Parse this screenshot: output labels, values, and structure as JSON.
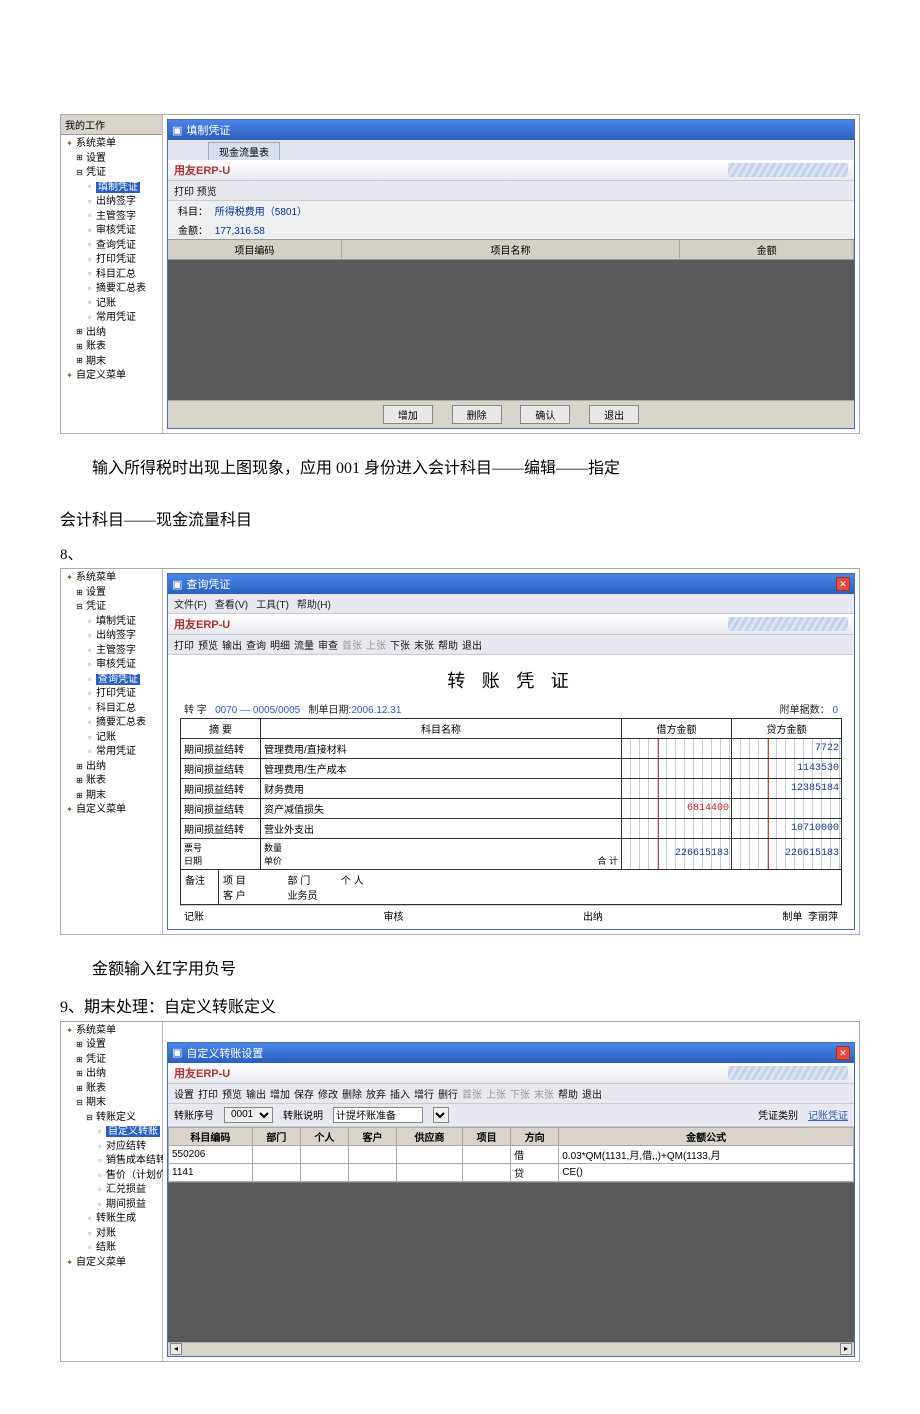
{
  "tree_header": "我的工作",
  "tree1": {
    "items": [
      {
        "label": "系统菜单",
        "lv": 0,
        "icon": "book"
      },
      {
        "label": "设置",
        "lv": 1,
        "icon": "plus"
      },
      {
        "label": "凭证",
        "lv": 1,
        "icon": "minus"
      },
      {
        "label": "填制凭证",
        "lv": 2,
        "icon": "doc",
        "hl": true
      },
      {
        "label": "出纳签字",
        "lv": 2,
        "icon": "doc"
      },
      {
        "label": "主管签字",
        "lv": 2,
        "icon": "doc"
      },
      {
        "label": "审核凭证",
        "lv": 2,
        "icon": "doc"
      },
      {
        "label": "查询凭证",
        "lv": 2,
        "icon": "doc"
      },
      {
        "label": "打印凭证",
        "lv": 2,
        "icon": "doc"
      },
      {
        "label": "科目汇总",
        "lv": 2,
        "icon": "doc"
      },
      {
        "label": "摘要汇总表",
        "lv": 2,
        "icon": "doc"
      },
      {
        "label": "记账",
        "lv": 2,
        "icon": "doc"
      },
      {
        "label": "常用凭证",
        "lv": 2,
        "icon": "doc"
      },
      {
        "label": "出纳",
        "lv": 1,
        "icon": "plus"
      },
      {
        "label": "账表",
        "lv": 1,
        "icon": "plus"
      },
      {
        "label": "期末",
        "lv": 1,
        "icon": "plus"
      },
      {
        "label": "自定义菜单",
        "lv": 0,
        "icon": "book"
      }
    ]
  },
  "shot1": {
    "title": "填制凭证",
    "tab": "现金流量表",
    "subject_label": "科目：",
    "subject_value": "所得税费用（5801）",
    "amount_label": "金额：",
    "amount_value": "177,316.58",
    "col1": "项目编码",
    "col2": "项目名称",
    "col3": "金额",
    "btn_add": "增加",
    "btn_del": "删除",
    "btn_ok": "确认",
    "btn_exit": "退出",
    "brand": "用友ERP-",
    "brand_u": "U",
    "toolbar_left": "打印 预览"
  },
  "para1a": "输入所得税时出现上图现象，应用 001 身份进入会计科目——编辑——指定",
  "para1b": "会计科目——现金流量科目",
  "section8": "8、",
  "tree2": {
    "items": [
      {
        "label": "系统菜单",
        "lv": 0,
        "icon": "book"
      },
      {
        "label": "设置",
        "lv": 1,
        "icon": "plus"
      },
      {
        "label": "凭证",
        "lv": 1,
        "icon": "minus"
      },
      {
        "label": "填制凭证",
        "lv": 2,
        "icon": "doc"
      },
      {
        "label": "出纳签字",
        "lv": 2,
        "icon": "doc"
      },
      {
        "label": "主管签字",
        "lv": 2,
        "icon": "doc"
      },
      {
        "label": "审核凭证",
        "lv": 2,
        "icon": "doc"
      },
      {
        "label": "查询凭证",
        "lv": 2,
        "icon": "doc",
        "hl": true
      },
      {
        "label": "打印凭证",
        "lv": 2,
        "icon": "doc"
      },
      {
        "label": "科目汇总",
        "lv": 2,
        "icon": "doc"
      },
      {
        "label": "摘要汇总表",
        "lv": 2,
        "icon": "doc"
      },
      {
        "label": "记账",
        "lv": 2,
        "icon": "doc"
      },
      {
        "label": "常用凭证",
        "lv": 2,
        "icon": "doc"
      },
      {
        "label": "出纳",
        "lv": 1,
        "icon": "plus"
      },
      {
        "label": "账表",
        "lv": 1,
        "icon": "plus"
      },
      {
        "label": "期末",
        "lv": 1,
        "icon": "plus"
      },
      {
        "label": "自定义菜单",
        "lv": 0,
        "icon": "book"
      }
    ]
  },
  "shot2": {
    "title": "查询凭证",
    "menu": [
      "文件(F)",
      "查看(V)",
      "工具(T)",
      "帮助(H)"
    ],
    "brand": "用友ERP-",
    "brand_u": "U",
    "toolbar": [
      "打印",
      "预览",
      "输出",
      "查询",
      "明细",
      "流量",
      "审查",
      "首张",
      "上张",
      "下张",
      "末张",
      "帮助",
      "退出"
    ],
    "toolbar_dim": [
      7,
      8
    ],
    "voucher_title": "转 账 凭 证",
    "meta_left_prefix": "转   字",
    "meta_seq": "0070 — 0005/0005",
    "meta_date_label": "制单日期:",
    "meta_date": "2006.12.31",
    "meta_right_label": "附单据数：",
    "meta_right_val": "0",
    "headers": [
      "摘 要",
      "科目名称",
      "借方金额",
      "贷方金额"
    ],
    "rows": [
      {
        "summary": "期间损益结转",
        "subject": "管理费用/直接材料",
        "debit": "",
        "credit": "7722"
      },
      {
        "summary": "期间损益结转",
        "subject": "管理费用/生产成本",
        "debit": "",
        "credit": "1143530"
      },
      {
        "summary": "期间损益结转",
        "subject": "财务费用",
        "debit": "",
        "credit": "12385184"
      },
      {
        "summary": "期间损益结转",
        "subject": "资产减值损失",
        "debit": "6814400",
        "credit": "",
        "neg": true
      },
      {
        "summary": "期间损益结转",
        "subject": "营业外支出",
        "debit": "",
        "credit": "10710000"
      }
    ],
    "total_label": "合 计",
    "total_debit": "226615183",
    "total_credit": "226615183",
    "sub_labels": {
      "piaohao": "票号",
      "riqi": "日期",
      "shuliang": "数量",
      "danjia": "单价",
      "xiangmu": "项 目",
      "kehu": "客 户",
      "bumen": "部 门",
      "yewuyuan": "业务员",
      "geren": "个 人",
      "beizhu": "备注"
    },
    "footer": {
      "jizhang": "记账",
      "shenhe": "审核",
      "chuna": "出纳",
      "zhidan": "制单",
      "person": "李丽萍"
    }
  },
  "para2": "金额输入红字用负号",
  "section9": "9、期末处理：自定义转账定义",
  "tree3": {
    "items": [
      {
        "label": "系统菜单",
        "lv": 0,
        "icon": "book"
      },
      {
        "label": "设置",
        "lv": 1,
        "icon": "plus"
      },
      {
        "label": "凭证",
        "lv": 1,
        "icon": "plus"
      },
      {
        "label": "出纳",
        "lv": 1,
        "icon": "plus"
      },
      {
        "label": "账表",
        "lv": 1,
        "icon": "plus"
      },
      {
        "label": "期末",
        "lv": 1,
        "icon": "minus"
      },
      {
        "label": "转账定义",
        "lv": 2,
        "icon": "minus"
      },
      {
        "label": "自定义转账",
        "lv": 3,
        "icon": "doc",
        "hl": true
      },
      {
        "label": "对应结转",
        "lv": 3,
        "icon": "doc"
      },
      {
        "label": "销售成本结转",
        "lv": 3,
        "icon": "doc"
      },
      {
        "label": "售价（计划价）",
        "lv": 3,
        "icon": "doc"
      },
      {
        "label": "汇兑损益",
        "lv": 3,
        "icon": "doc"
      },
      {
        "label": "期间损益",
        "lv": 3,
        "icon": "doc"
      },
      {
        "label": "转账生成",
        "lv": 2,
        "icon": "doc"
      },
      {
        "label": "对账",
        "lv": 2,
        "icon": "doc"
      },
      {
        "label": "结账",
        "lv": 2,
        "icon": "doc"
      },
      {
        "label": "自定义菜单",
        "lv": 0,
        "icon": "book"
      }
    ]
  },
  "shot3": {
    "title": "自定义转账设置",
    "brand": "用友ERP-",
    "brand_u": "U",
    "toolbar": [
      "设置",
      "打印",
      "预览",
      "输出",
      "增加",
      "保存",
      "修改",
      "删除",
      "放弃",
      "插入",
      "增行",
      "删行",
      "首张",
      "上张",
      "下张",
      "末张",
      "帮助",
      "退出"
    ],
    "toolbar_dim": [
      12,
      13,
      14,
      15
    ],
    "form": {
      "seq_label": "转账序号",
      "seq_value": "0001",
      "desc_label": "转账说明",
      "desc_value": "计提坏账准备",
      "type_label": "凭证类别",
      "type_value": "记账凭证"
    },
    "grid_headers": [
      "科目编码",
      "部门",
      "个人",
      "客户",
      "供应商",
      "项目",
      "方向",
      "金额公式"
    ],
    "grid_rows": [
      {
        "code": "550206",
        "dir": "借",
        "formula": "0.03*QM(1131,月,借,,)+QM(1133,月"
      },
      {
        "code": "1141",
        "dir": "贷",
        "formula": "CE()"
      }
    ]
  }
}
